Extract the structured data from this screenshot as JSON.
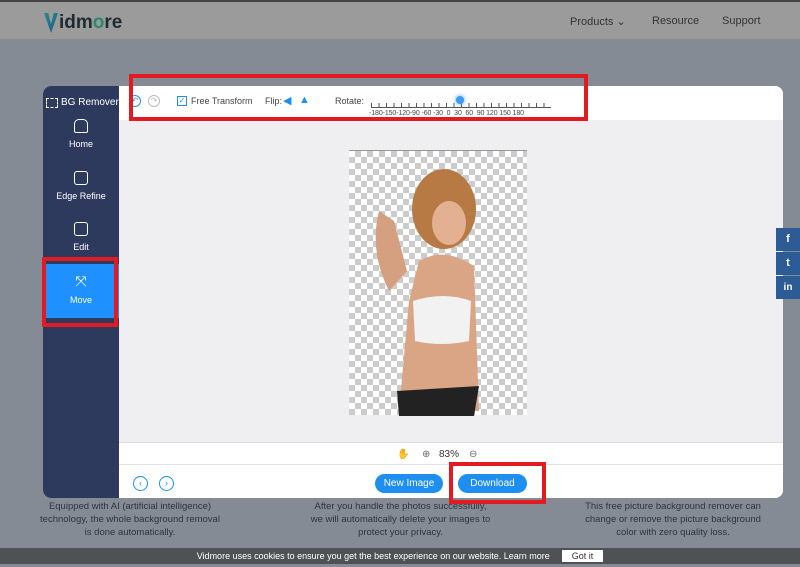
{
  "header": {
    "logo": "Vidmore",
    "nav": [
      "Products",
      "Resource",
      "Support"
    ]
  },
  "sidebar": {
    "title": "BG Remover",
    "items": [
      {
        "label": "Home",
        "icon": "home-icon"
      },
      {
        "label": "Edge Refine",
        "icon": "edit-icon"
      },
      {
        "label": "Edit",
        "icon": "image-icon"
      },
      {
        "label": "Move",
        "icon": "move-icon",
        "active": true
      }
    ]
  },
  "toolbar": {
    "free_transform": "Free Transform",
    "free_transform_checked": true,
    "flip_label": "Flip:",
    "rotate_label": "Rotate:",
    "rotate_ticks": "-180-150-120-90 -60 -30  0  30  60  90 120 150 180",
    "rotate_value": 0
  },
  "zoom": {
    "value": "83%"
  },
  "buttons": {
    "new_image": "New Image",
    "download": "Download"
  },
  "features": [
    "Equipped with AI (artificial intelligence) technology, the whole background removal is done automatically.",
    "After you handle the photos successfully, we will automatically delete your images to protect your privacy.",
    "This free picture background remover can change or remove the picture background color with zero quality loss."
  ],
  "social": [
    "f",
    "t",
    "in"
  ],
  "cookie": {
    "text": "Vidmore uses cookies to ensure you get the best experience on our website. Learn more",
    "button": "Got it"
  },
  "colors": {
    "accent": "#1e8ff0",
    "sidebar": "#2d3a5e",
    "highlight": "#e21a22"
  }
}
